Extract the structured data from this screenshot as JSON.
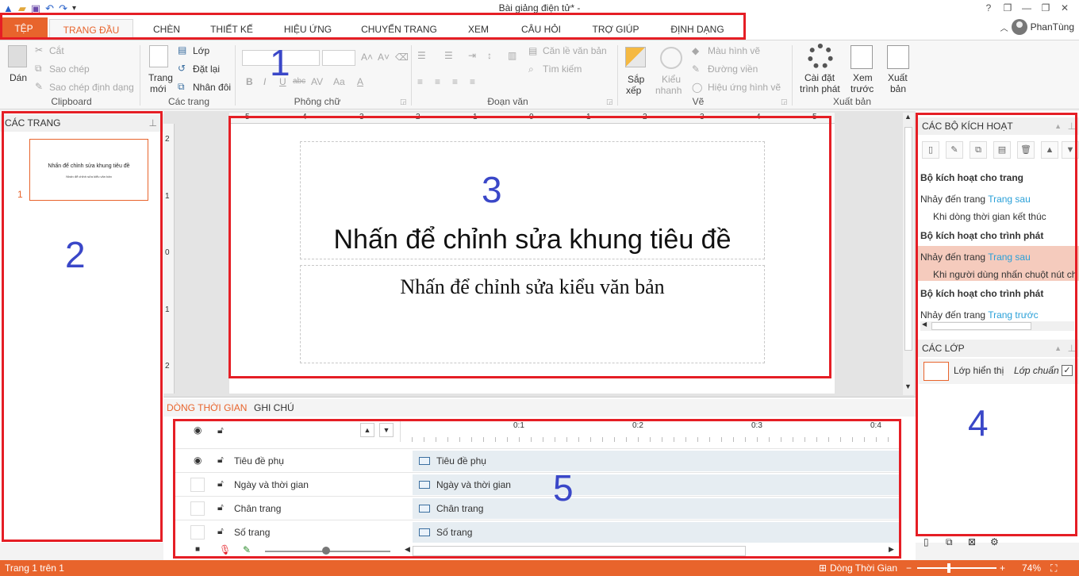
{
  "window": {
    "title": "Bài giảng điện tử* - ",
    "user_name": "PhanTùng"
  },
  "tabs": {
    "file": "TỆP",
    "items": [
      "TRANG ĐẦU",
      "CHÈN",
      "THIẾT KẾ",
      "HIỆU ỨNG",
      "CHUYỂN TRANG",
      "XEM",
      "CÂU HỎI",
      "TRỢ GIÚP",
      "ĐỊNH DẠNG"
    ]
  },
  "ribbon": {
    "clipboard": {
      "paste": "Dán",
      "cut": "Cắt",
      "copy": "Sao chép",
      "format_painter": "Sao chép định dạng",
      "label": "Clipboard"
    },
    "pages": {
      "new_page_1": "Trang",
      "new_page_2": "mới",
      "layer": "Lớp",
      "reset": "Đặt lại",
      "duplicate": "Nhân đôi",
      "label": "Các trang"
    },
    "font": {
      "label": "Phông chữ"
    },
    "paragraph": {
      "align_text": "Căn lề văn bản",
      "find": "Tìm kiếm",
      "label": "Đoạn văn"
    },
    "drawing": {
      "arrange_1": "Sắp",
      "arrange_2": "xếp",
      "style_1": "Kiểu",
      "style_2": "nhanh",
      "shape_color": "Màu hình vẽ",
      "outline": "Đường viền",
      "shape_effect": "Hiệu ứng hình vẽ",
      "label": "Vẽ"
    },
    "publish": {
      "player_settings_1": "Cài đặt",
      "player_settings_2": "trình phát",
      "preview_1": "Xem",
      "preview_2": "trước",
      "publish_1": "Xuất",
      "publish_2": "bản",
      "label": "Xuất bản"
    }
  },
  "left_pane": {
    "header": "CÁC TRANG",
    "slide_number": "1",
    "thumb_title": "Nhấn để chỉnh sửa khung tiêu đề",
    "thumb_subtitle": "Nhấn để chỉnh sửa kiểu văn bản"
  },
  "slide": {
    "title_placeholder": "Nhấn để chỉnh sửa khung tiêu đề",
    "subtitle_placeholder": "Nhấn để chỉnh sửa kiểu văn bản"
  },
  "ruler_h_labels": [
    "5",
    "4",
    "3",
    "2",
    "1",
    "0",
    "1",
    "2",
    "3",
    "4",
    "5"
  ],
  "ruler_v_labels": [
    "2",
    "1",
    "0",
    "1",
    "2"
  ],
  "timeline": {
    "tab_timeline": "DÒNG THỜI GIAN",
    "tab_notes": "GHI CHÚ",
    "ticks": [
      "0:1",
      "0:2",
      "0:3",
      "0:4"
    ],
    "rows": [
      {
        "name": "Tiêu đề phụ",
        "visible": true
      },
      {
        "name": "Ngày và thời gian",
        "visible": false
      },
      {
        "name": "Chân trang",
        "visible": false
      },
      {
        "name": "Số trang",
        "visible": false
      }
    ]
  },
  "right_pane": {
    "triggers_header": "CÁC BỘ KÍCH HOẠT",
    "slide_triggers": "Bộ kích hoạt cho trang",
    "jump_to": "Nhảy đến trang",
    "next_slide": "Trang sau",
    "when_timeline_ends": "Khi dòng thời gian kết thúc",
    "player_triggers": "Bộ kích hoạt cho trình phát",
    "when_user_clicks": "Khi người dùng nhấn chuột nút ch",
    "player_triggers_2": "Bộ kích hoạt cho trình phát",
    "prev_slide": "Trang trước",
    "layers_header": "CÁC LỚP",
    "base_layer": "Lớp hiển thị",
    "layer_default": "Lớp chuẩn"
  },
  "statusbar": {
    "page_info": "Trang 1 trên 1",
    "timeline": "Dòng Thời Gian",
    "zoom": "74%"
  },
  "annotations": [
    "1",
    "2",
    "3",
    "4",
    "5"
  ],
  "colors": {
    "accent": "#e8642c",
    "annotation_red": "#e51e25",
    "annotation_blue": "#3a47c8",
    "link": "#2aa0d8"
  }
}
